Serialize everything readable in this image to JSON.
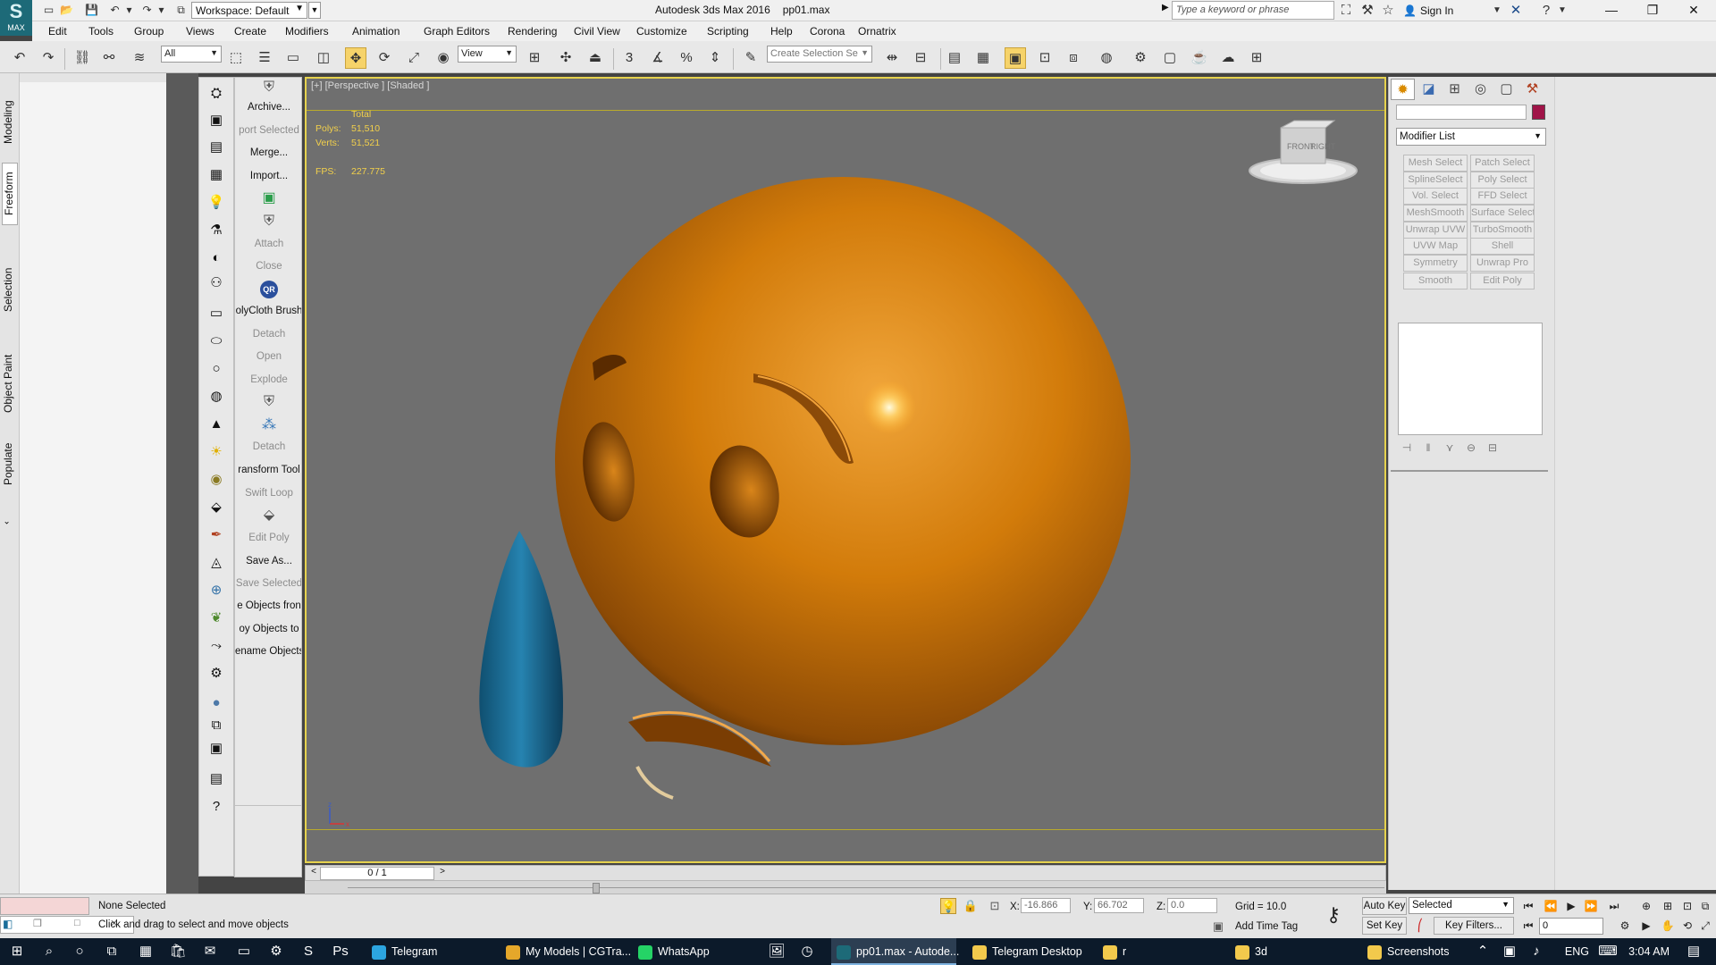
{
  "app": {
    "logo_text": "MAX",
    "title": "Autodesk 3ds Max 2016",
    "file": "pp01.max",
    "workspace_label": "Workspace: Default",
    "search_placeholder": "Type a keyword or phrase",
    "sign_in": "Sign In"
  },
  "menu": [
    "Edit",
    "Tools",
    "Group",
    "Views",
    "Create",
    "Modifiers",
    "Animation",
    "Graph Editors",
    "Rendering",
    "Civil View",
    "Customize",
    "Scripting",
    "Help",
    "Corona",
    "Ornatrix"
  ],
  "toolbar": {
    "filter": "All",
    "ref_coord": "View",
    "selection_set_placeholder": "Create Selection Se"
  },
  "ribbon_tabs": [
    "Modeling",
    "Freeform",
    "Selection",
    "Object Paint",
    "Populate"
  ],
  "tool_column": [
    {
      "label": "",
      "icon": "shield-icon",
      "enabled": false
    },
    {
      "label": "Archive...",
      "enabled": true
    },
    {
      "label": "port Selected",
      "enabled": false
    },
    {
      "label": "Merge...",
      "enabled": true
    },
    {
      "label": "Import...",
      "enabled": true
    },
    {
      "label": "",
      "icon": "screen-icon",
      "enabled": true
    },
    {
      "label": "",
      "icon": "attach-shape-icon",
      "enabled": false
    },
    {
      "label": "Attach",
      "enabled": false
    },
    {
      "label": "Close",
      "enabled": false
    },
    {
      "label": "QR",
      "icon": "qr-icon",
      "enabled": true
    },
    {
      "label": "olyCloth Brush",
      "enabled": true
    },
    {
      "label": "Detach",
      "enabled": false
    },
    {
      "label": "Open",
      "enabled": false
    },
    {
      "label": "Explode",
      "enabled": false
    },
    {
      "label": "",
      "icon": "shield-icon",
      "enabled": false
    },
    {
      "label": "",
      "icon": "dots-icon",
      "enabled": true
    },
    {
      "label": "Detach",
      "enabled": false
    },
    {
      "label": "ransform Tool",
      "enabled": true
    },
    {
      "label": "Swift Loop",
      "enabled": false
    },
    {
      "label": "",
      "icon": "stack-icon",
      "enabled": false
    },
    {
      "label": "Edit Poly",
      "enabled": false
    },
    {
      "label": "Save As...",
      "enabled": true
    },
    {
      "label": "Save Selected",
      "enabled": false
    },
    {
      "label": "e Objects fron",
      "enabled": true
    },
    {
      "label": "oy Objects to",
      "enabled": true
    },
    {
      "label": "ename Objects",
      "enabled": true
    }
  ],
  "viewport": {
    "label": "[+] [Perspective ] [Shaded ]",
    "stats": {
      "total_label": "Total",
      "polys_label": "Polys:",
      "polys": "51,510",
      "verts_label": "Verts:",
      "verts": "51,521",
      "fps_label": "FPS:",
      "fps": "227.775"
    },
    "viewcube": {
      "front": "FRONT",
      "right": "RIGHT"
    },
    "axis_z": "z",
    "axis_x": "x",
    "colors": {
      "emoji": "#d27b0a",
      "tear": "#1f6e95",
      "background": "#6f6f6f",
      "border": "#e6d24e"
    }
  },
  "timeline": {
    "frame": "0 / 1"
  },
  "command_panel": {
    "modifier_list": "Modifier List",
    "modifiers": [
      [
        "Mesh Select",
        "Patch Select"
      ],
      [
        "SplineSelect",
        "Poly Select"
      ],
      [
        "Vol. Select",
        "FFD Select"
      ],
      [
        "MeshSmooth",
        "Surface Select"
      ],
      [
        "Unwrap UVW",
        "TurboSmooth"
      ],
      [
        "UVW Map",
        "Shell"
      ],
      [
        "Symmetry",
        "Unwrap Pro"
      ],
      [
        "Smooth",
        "Edit Poly"
      ]
    ]
  },
  "status": {
    "selection": "None Selected",
    "prompt": "Click and drag to select and move objects",
    "x_label": "X:",
    "x": "-16.866",
    "y_label": "Y:",
    "y": "66.702",
    "z_label": "Z:",
    "z": "0.0",
    "grid": "Grid = 10.0",
    "add_time_tag": "Add Time Tag",
    "auto_key": "Auto Key",
    "set_key": "Set Key",
    "key_mode": "Selected",
    "key_filters": "Key Filters...",
    "frame_value": "0"
  },
  "taskbar": {
    "apps": [
      {
        "label": "Telegram",
        "color": "#2ca5e0"
      },
      {
        "label": "My Models | CGTra...",
        "color": "#e5a72a"
      },
      {
        "label": "WhatsApp",
        "color": "#25d366"
      },
      {
        "label": "pp01.max - Autode...",
        "color": "#1d6a78"
      },
      {
        "label": "Telegram Desktop",
        "color": "#f2c94c"
      },
      {
        "label": "r",
        "color": "#f2c94c"
      },
      {
        "label": "3d",
        "color": "#f2c94c"
      },
      {
        "label": "Screenshots",
        "color": "#f2c94c"
      }
    ],
    "lang": "ENG",
    "time": "3:04 AM"
  }
}
